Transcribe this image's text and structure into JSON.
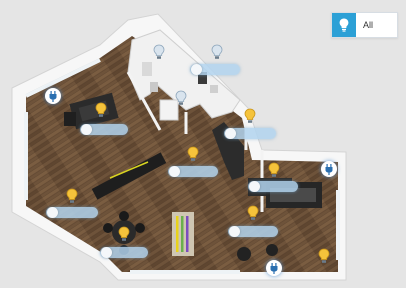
{
  "filter": {
    "label": "All",
    "icon": "lightbulb-icon"
  },
  "controls": [
    {
      "id": "hall-light",
      "label": ""
    },
    {
      "id": "lounge-light",
      "label": ""
    },
    {
      "id": "corridor-light",
      "label": ""
    },
    {
      "id": "tv-area-light",
      "label": ""
    },
    {
      "id": "kitchen-light",
      "label": ""
    },
    {
      "id": "window-light",
      "label": ""
    },
    {
      "id": "dining-light",
      "label": ""
    },
    {
      "id": "desk-light",
      "label": ""
    }
  ],
  "plugs": [
    {
      "id": "plug-left",
      "icon": "power-plug-icon"
    },
    {
      "id": "plug-kitchen",
      "icon": "power-plug-icon"
    },
    {
      "id": "plug-bottom",
      "icon": "power-plug-icon"
    }
  ],
  "colors": {
    "accent": "#2ca0d6",
    "bulb_on": "#f5c33b",
    "bulb_off": "#d9e4ee",
    "floor": "#6b5138",
    "wall": "#f6f6f6"
  }
}
